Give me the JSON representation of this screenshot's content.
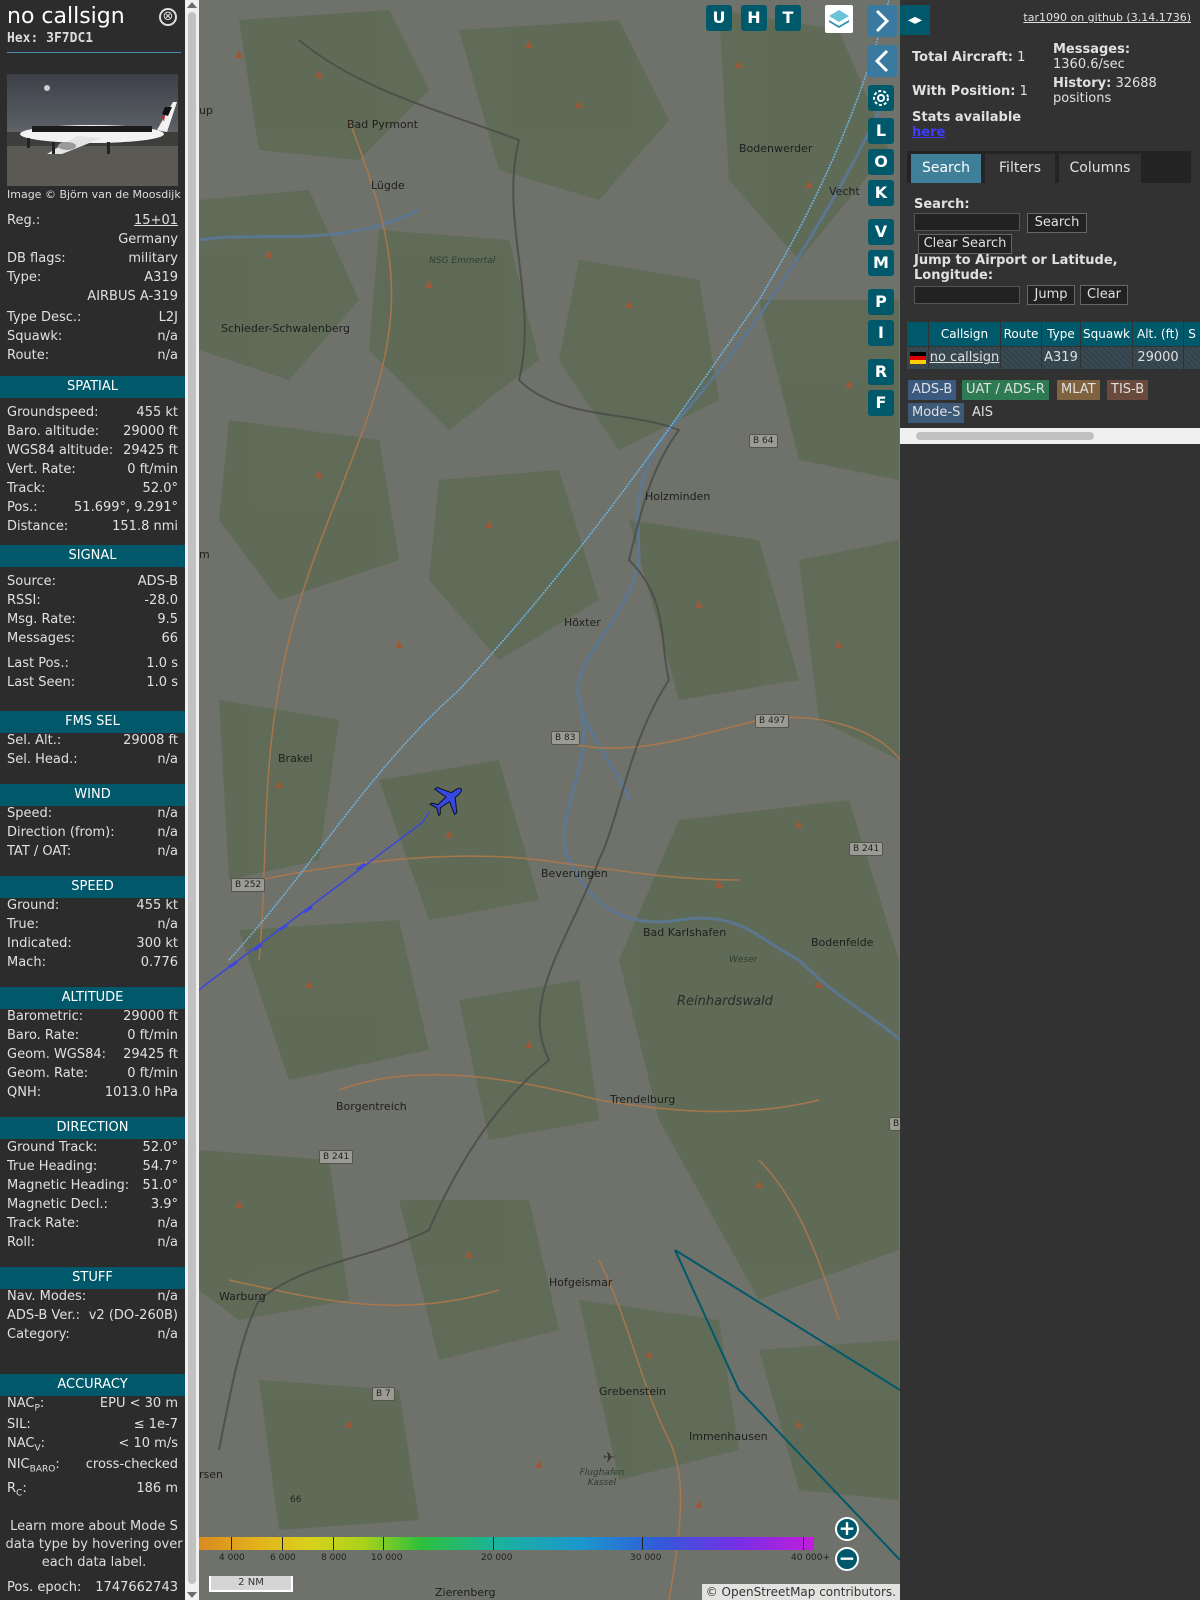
{
  "aircraft": {
    "callsign": "no callsign",
    "hex_label": "Hex:",
    "hex": "3F7DC1",
    "image_credit": "Image © Björn van de Moosdijk",
    "close_symbol": "⊗"
  },
  "details": [
    {
      "key": "Reg.:",
      "value": "15+01",
      "link": true
    },
    {
      "key": "",
      "value": "Germany"
    },
    {
      "key": "DB flags:",
      "value": "military"
    },
    {
      "key": "Type:",
      "value": "A319"
    },
    {
      "key": "",
      "value": "AIRBUS A-319"
    },
    {
      "key": "Type Desc.:",
      "value": "L2J"
    },
    {
      "key": "Squawk:",
      "value": "n/a"
    },
    {
      "key": "Route:",
      "value": "n/a"
    }
  ],
  "sections": {
    "spatial": {
      "title": "SPATIAL",
      "rows": [
        {
          "key": "Groundspeed:",
          "value": "455 kt"
        },
        {
          "key": "Baro. altitude:",
          "value": "29000 ft"
        },
        {
          "key": "WGS84 altitude:",
          "value": "29425 ft"
        },
        {
          "key": "Vert. Rate:",
          "value": "0 ft/min"
        },
        {
          "key": "Track:",
          "value": "52.0°"
        },
        {
          "key": "Pos.:",
          "value": "51.699°, 9.291°"
        },
        {
          "key": "Distance:",
          "value": "151.8 nmi"
        }
      ]
    },
    "signal": {
      "title": "SIGNAL",
      "rows": [
        {
          "key": "Source:",
          "value": "ADS-B"
        },
        {
          "key": "RSSI:",
          "value": "-28.0"
        },
        {
          "key": "Msg. Rate:",
          "value": "9.5"
        },
        {
          "key": "Messages:",
          "value": "66"
        },
        {
          "key": "Last Pos.:",
          "value": "1.0 s"
        },
        {
          "key": "Last Seen:",
          "value": "1.0 s"
        }
      ]
    },
    "fms": {
      "title": "FMS SEL",
      "rows": [
        {
          "key": "Sel. Alt.:",
          "value": "29008 ft"
        },
        {
          "key": "Sel. Head.:",
          "value": "n/a"
        }
      ]
    },
    "wind": {
      "title": "WIND",
      "rows": [
        {
          "key": "Speed:",
          "value": "n/a"
        },
        {
          "key": "Direction (from):",
          "value": "n/a"
        },
        {
          "key": "TAT / OAT:",
          "value": "n/a"
        }
      ]
    },
    "speed": {
      "title": "SPEED",
      "rows": [
        {
          "key": "Ground:",
          "value": "455 kt"
        },
        {
          "key": "True:",
          "value": "n/a"
        },
        {
          "key": "Indicated:",
          "value": "300 kt"
        },
        {
          "key": "Mach:",
          "value": "0.776"
        }
      ]
    },
    "altitude": {
      "title": "ALTITUDE",
      "rows": [
        {
          "key": "Barometric:",
          "value": "29000 ft"
        },
        {
          "key": "Baro. Rate:",
          "value": "0 ft/min"
        },
        {
          "key": "Geom. WGS84:",
          "value": "29425 ft"
        },
        {
          "key": "Geom. Rate:",
          "value": "0 ft/min"
        },
        {
          "key": "QNH:",
          "value": "1013.0 hPa"
        }
      ]
    },
    "direction": {
      "title": "DIRECTION",
      "rows": [
        {
          "key": "Ground Track:",
          "value": "52.0°"
        },
        {
          "key": "True Heading:",
          "value": "54.7°"
        },
        {
          "key": "Magnetic Heading:",
          "value": "51.0°"
        },
        {
          "key": "Magnetic Decl.:",
          "value": "3.9°"
        },
        {
          "key": "Track Rate:",
          "value": "n/a"
        },
        {
          "key": "Roll:",
          "value": "n/a"
        }
      ]
    },
    "stuff": {
      "title": "STUFF",
      "rows": [
        {
          "key": "Nav. Modes:",
          "value": "n/a"
        },
        {
          "key": "ADS-B Ver.:",
          "value": "v2 (DO-260B)"
        },
        {
          "key": "Category:",
          "value": "n/a"
        }
      ]
    },
    "accuracy": {
      "title": "ACCURACY",
      "rows": [
        {
          "key": "NAC",
          "sub": "P",
          "value": "EPU < 30 m"
        },
        {
          "key": "SIL:",
          "value": "≤ 1e-7"
        },
        {
          "key": "NAC",
          "sub": "V",
          "value": "< 10 m/s"
        },
        {
          "key": "NIC",
          "sub": "BARO",
          "value": "cross-checked"
        },
        {
          "key": "R",
          "sub": "C",
          "value": "186 m"
        }
      ]
    }
  },
  "learn_more": "Learn more about Mode S data type by hovering over each data label.",
  "pos_epoch": {
    "key": "Pos. epoch:",
    "value": "1747662743"
  },
  "map": {
    "buttons_top": [
      "U",
      "H",
      "T"
    ],
    "buttons_side": [
      "L",
      "O",
      "K",
      "V",
      "M",
      "P",
      "I",
      "R",
      "F"
    ],
    "towns": [
      {
        "name": "Bad Pyrmont"
      },
      {
        "name": "Lügde"
      },
      {
        "name": "Bodenwerder"
      },
      {
        "name": "NSG Emmertal"
      },
      {
        "name": "Schieder-Schwalenberg"
      },
      {
        "name": "Holzminden"
      },
      {
        "name": "Höxter"
      },
      {
        "name": "Brakel"
      },
      {
        "name": "Beverungen"
      },
      {
        "name": "Bad Karlshafen"
      },
      {
        "name": "Bodenfelde"
      },
      {
        "name": "Borgentreich"
      },
      {
        "name": "Trendelburg"
      },
      {
        "name": "Hofgeismar"
      },
      {
        "name": "Warburg"
      },
      {
        "name": "Grebenstein"
      },
      {
        "name": "Immenhausen"
      },
      {
        "name": "Flughafen Kassel"
      },
      {
        "name": "Zierenberg"
      },
      {
        "name": "Vecht"
      },
      {
        "name": "up"
      },
      {
        "name": "m"
      },
      {
        "name": "rsen"
      },
      {
        "name": "Weser"
      }
    ],
    "roads": [
      "B 64",
      "B 83",
      "B 497",
      "B 241",
      "B 252",
      "B 241",
      "B 7",
      "B",
      "66"
    ],
    "region": "Reinhardswald",
    "altitude_labels": [
      "4 000",
      "6 000",
      "8 000",
      "10 000",
      "20 000",
      "30 000",
      "40 000+"
    ],
    "scale": "2 NM",
    "attribution": "© OpenStreetMap contributors.",
    "zoom_in": "+",
    "zoom_out": "−",
    "colors": {
      "track_old": "#6db4e6",
      "track_recent": "#3b46e0",
      "plane": "#3548e6",
      "range_ring": "#00596b"
    }
  },
  "rightpanel": {
    "github": "tar1090 on github (3.14.1736)",
    "expand_icon": "◂▸",
    "total_aircraft_label": "Total Aircraft:",
    "total_aircraft": "1",
    "with_position_label": "With Position:",
    "with_position": "1",
    "messages_label": "Messages:",
    "messages": "1360.6/sec",
    "history_label": "History:",
    "history": "32688",
    "history_unit": "positions",
    "stats_label": "Stats available",
    "stats_link": "here",
    "tabs": [
      "Search",
      "Filters",
      "Columns"
    ],
    "search_label": "Search:",
    "search_button": "Search",
    "clear_search": "Clear Search",
    "jump_label": "Jump to Airport or Latitude, Longitude:",
    "jump_button": "Jump",
    "clear_button": "Clear",
    "table_headers": [
      "Callsign",
      "Route",
      "Type",
      "Squawk",
      "Alt. (ft)",
      "S"
    ],
    "table_row": {
      "callsign": "no callsign",
      "route": "",
      "type": "A319",
      "squawk": "",
      "alt": "29000"
    },
    "legend": [
      {
        "label": "ADS-B",
        "color": "#3c5a80"
      },
      {
        "label": "UAT / ADS-R",
        "color": "#2e7a52"
      },
      {
        "label": "MLAT",
        "color": "#7f6340"
      },
      {
        "label": "TIS-B",
        "color": "#6b4a3e"
      },
      {
        "label": "Mode-S",
        "color": "#3d5a78"
      },
      {
        "label": "AIS",
        "color": "#323232"
      }
    ]
  }
}
